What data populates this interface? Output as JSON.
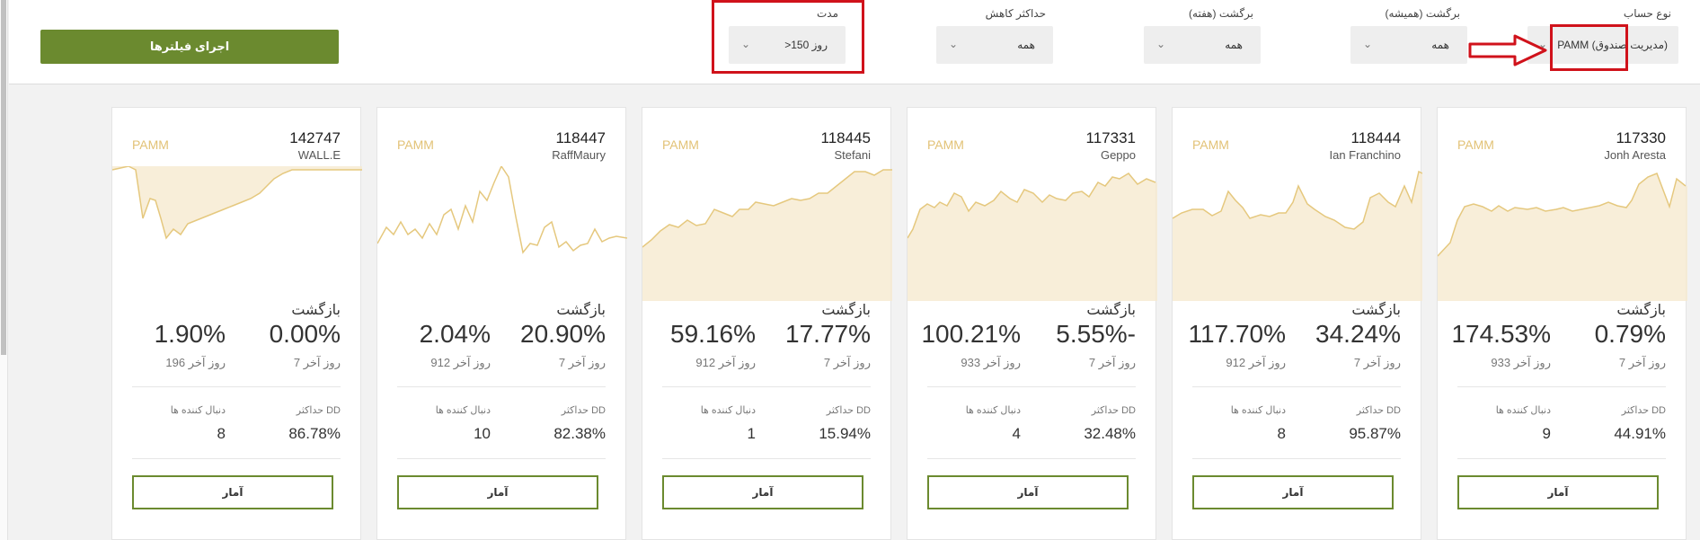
{
  "toolbar": {
    "run_filters_label": "اجرای فیلترها"
  },
  "filters": [
    {
      "label": "نوع حساب",
      "value": "PAMM (مدیریت صندوق)"
    },
    {
      "label": "برگشت (همیشه)",
      "value": "همه"
    },
    {
      "label": "برگشت (هفته)",
      "value": "همه"
    },
    {
      "label": "حداکثر کاهش",
      "value": "همه"
    },
    {
      "label": "مدت",
      "value": ">150 روز"
    }
  ],
  "colors": {
    "accent": "#6b8a2f",
    "highlight": "#d0121b",
    "spark": "#e5c87e",
    "type_label": "#e2c276"
  },
  "cards": [
    {
      "id": "117330",
      "name": "Jonh Aresta",
      "type": "PAMM",
      "return_title": "بازگشت",
      "ret_7d": "0.79%",
      "ret_7d_label": "7 روز آخر",
      "ret_total": "174.53%",
      "ret_total_label": "933 روز آخر",
      "dd_label": "حداکثر DD",
      "dd": "44.91%",
      "followers_label": "دنبال کننده ها",
      "followers": "9",
      "button": "آمار"
    },
    {
      "id": "118444",
      "name": "Ian Franchino",
      "type": "PAMM",
      "return_title": "بازگشت",
      "ret_7d": "34.24%",
      "ret_7d_label": "7 روز آخر",
      "ret_total": "117.70%",
      "ret_total_label": "912 روز آخر",
      "dd_label": "حداکثر DD",
      "dd": "95.87%",
      "followers_label": "دنبال کننده ها",
      "followers": "8",
      "button": "آمار"
    },
    {
      "id": "117331",
      "name": "Geppo",
      "type": "PAMM",
      "return_title": "بازگشت",
      "ret_7d": "5.55%-",
      "ret_7d_label": "7 روز آخر",
      "ret_total": "100.21%",
      "ret_total_label": "933 روز آخر",
      "dd_label": "حداکثر DD",
      "dd": "32.48%",
      "followers_label": "دنبال کننده ها",
      "followers": "4",
      "button": "آمار"
    },
    {
      "id": "118445",
      "name": "Stefani",
      "type": "PAMM",
      "return_title": "بازگشت",
      "ret_7d": "17.77%",
      "ret_7d_label": "7 روز آخر",
      "ret_total": "59.16%",
      "ret_total_label": "912 روز آخر",
      "dd_label": "حداکثر DD",
      "dd": "15.94%",
      "followers_label": "دنبال کننده ها",
      "followers": "1",
      "button": "آمار"
    },
    {
      "id": "118447",
      "name": "RaffMaury",
      "type": "PAMM",
      "return_title": "بازگشت",
      "ret_7d": "20.90%",
      "ret_7d_label": "7 روز آخر",
      "ret_total": "2.04%",
      "ret_total_label": "912 روز آخر",
      "dd_label": "حداکثر DD",
      "dd": "82.38%",
      "followers_label": "دنبال کننده ها",
      "followers": "10",
      "button": "آمار"
    },
    {
      "id": "142747",
      "name": "WALL.E",
      "type": "PAMM",
      "return_title": "بازگشت",
      "ret_7d": "0.00%",
      "ret_7d_label": "7 روز آخر",
      "ret_total": "1.90%",
      "ret_total_label": "196 روز آخر",
      "dd_label": "حداکثر DD",
      "dd": "86.78%",
      "followers_label": "دنبال کننده ها",
      "followers": "8",
      "button": "آمار"
    }
  ]
}
